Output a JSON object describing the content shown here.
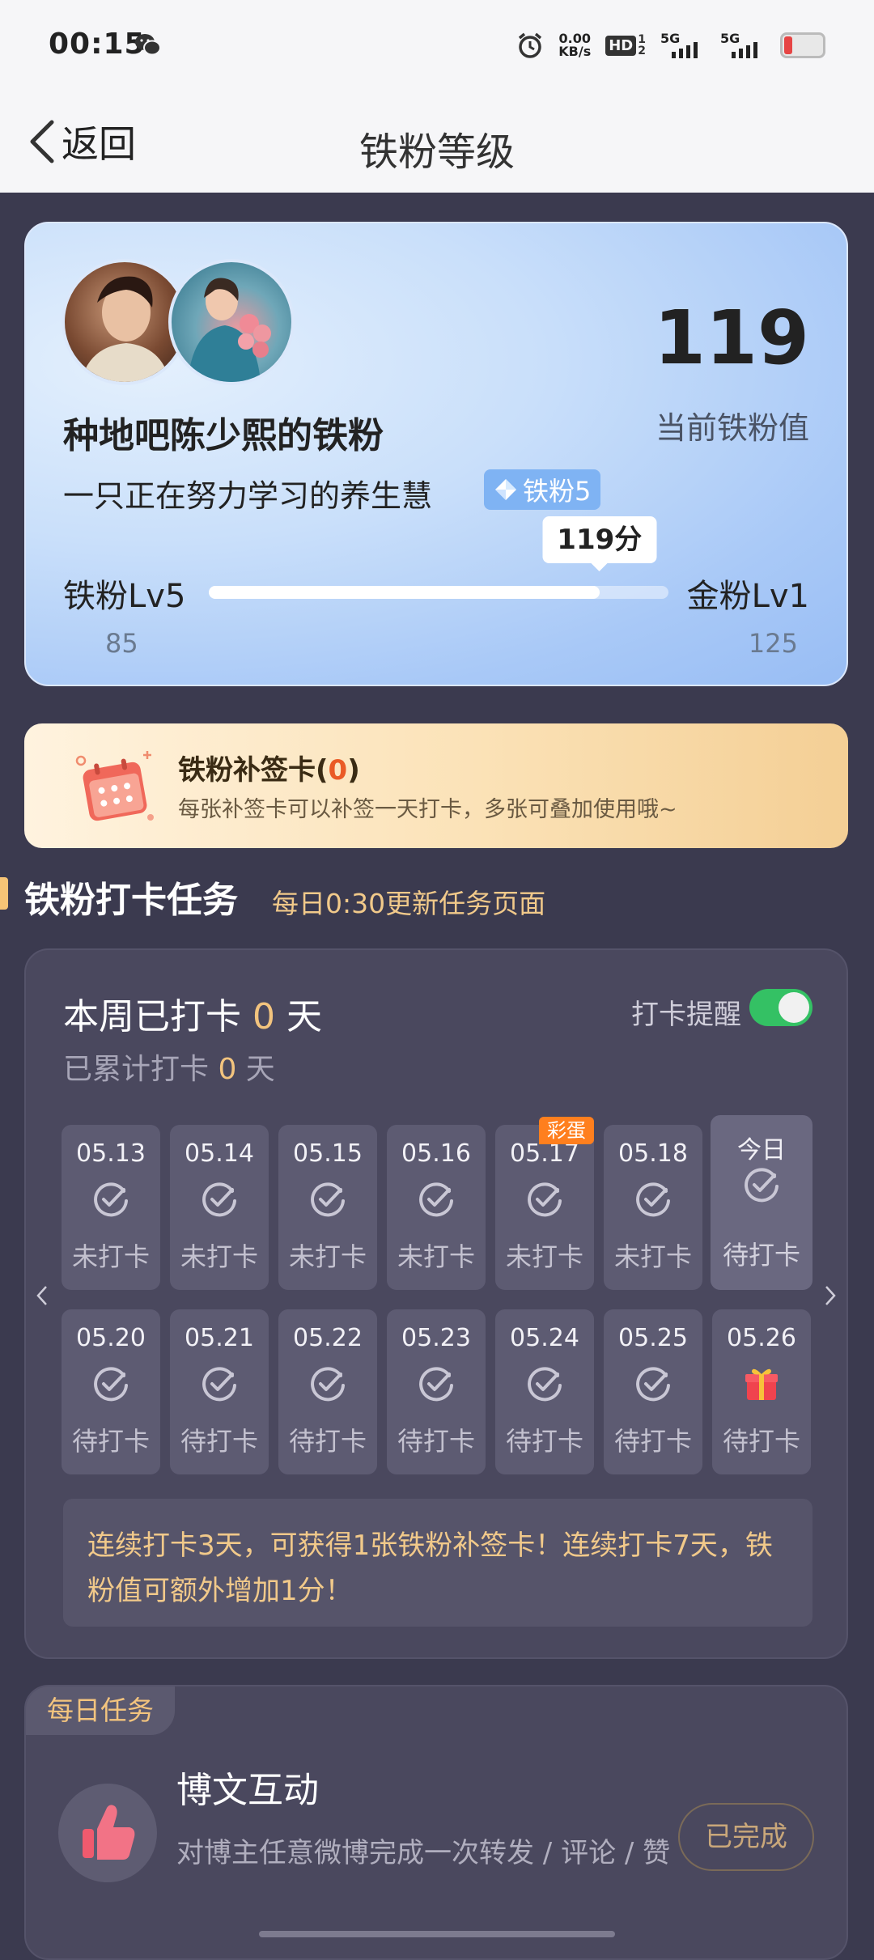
{
  "status_bar": {
    "time": "00:15",
    "net_speed": "0.00",
    "net_unit": "KB/s",
    "hd": "HD",
    "sim1": "5G",
    "sim2": "5G",
    "battery_color": "#e64545"
  },
  "header": {
    "back_label": "返回",
    "title": "铁粉等级"
  },
  "hero": {
    "fan_of": "种地吧陈少熙的铁粉",
    "username": "一只正在努力学习的养生慧",
    "badge": "铁粉5",
    "value": "119",
    "value_label": "当前铁粉值",
    "current_level": "铁粉Lv5",
    "next_level": "金粉Lv1",
    "min": "85",
    "max": "125",
    "tooltip": "119分",
    "progress_fraction": 0.85
  },
  "makeup_card": {
    "title_prefix": "铁粉补签卡(",
    "count": "0",
    "title_suffix": ")",
    "desc": "每张补签卡可以补签一天打卡，多张可叠加使用哦~"
  },
  "section": {
    "title": "铁粉打卡任务",
    "subtitle": "每日0:30更新任务页面"
  },
  "checkin": {
    "week_prefix": "本周已打卡 ",
    "week_count": "0",
    "week_suffix": " 天",
    "total_prefix": "已累计打卡 ",
    "total_count": "0",
    "total_suffix": " 天",
    "remind_label": "打卡提醒",
    "remind_on": true,
    "egg_label": "彩蛋",
    "days": [
      {
        "date": "05.13",
        "status": "未打卡"
      },
      {
        "date": "05.14",
        "status": "未打卡"
      },
      {
        "date": "05.15",
        "status": "未打卡"
      },
      {
        "date": "05.16",
        "status": "未打卡"
      },
      {
        "date": "05.17",
        "status": "未打卡"
      },
      {
        "date": "05.18",
        "status": "未打卡"
      },
      {
        "date": "今日",
        "status": "待打卡"
      },
      {
        "date": "05.20",
        "status": "待打卡"
      },
      {
        "date": "05.21",
        "status": "待打卡"
      },
      {
        "date": "05.22",
        "status": "待打卡"
      },
      {
        "date": "05.23",
        "status": "待打卡"
      },
      {
        "date": "05.24",
        "status": "待打卡"
      },
      {
        "date": "05.25",
        "status": "待打卡"
      },
      {
        "date": "05.26",
        "status": "待打卡"
      }
    ],
    "hint": "连续打卡3天，可获得1张铁粉补签卡！连续打卡7天，铁粉值可额外增加1分！"
  },
  "daily_task": {
    "tag": "每日任务",
    "title": "博文互动",
    "desc": "对博主任意微博完成一次转发 / 评论 / 赞",
    "button": "已完成",
    "icon": "thumbs-up-icon"
  }
}
